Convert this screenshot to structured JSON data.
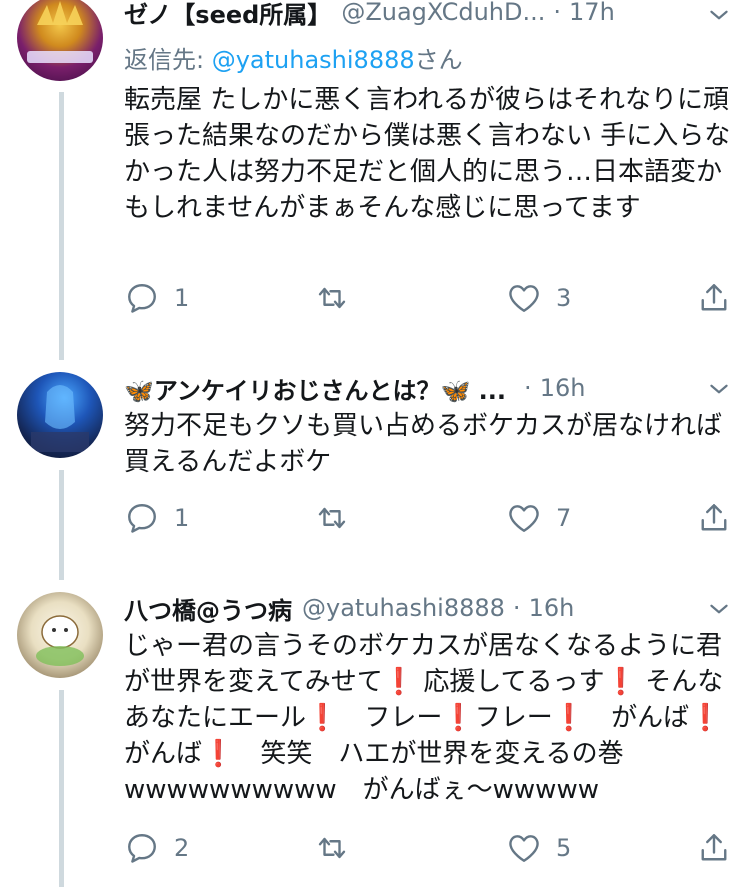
{
  "tweets": [
    {
      "name": "ゼノ【seed所属】",
      "handle": "@ZuagXCduhD...",
      "time": "17h",
      "reply_prefix": "返信先: ",
      "reply_handle": "@yatuhashi8888",
      "reply_suffix": "さん",
      "text": "転売屋 たしかに悪く言われるが彼らはそれなりに頑張った結果なのだから僕は悪く言わない 手に入らなかった人は努力不足だと個人的に思う…日本語変かもしれませんがまぁそんな感じに思ってます",
      "replies": "1",
      "retweets": "",
      "likes": "3"
    },
    {
      "name": "🦋アンケイリおじさんとは？🦋 ...",
      "handle": "",
      "time": "16h",
      "text": "努力不足もクソも買い占めるボケカスが居なければ買えるんだよボケ",
      "replies": "1",
      "retweets": "",
      "likes": "7"
    },
    {
      "name": "八つ橋@うつ病",
      "handle": "@yatuhashi8888",
      "time": "16h",
      "text": "じゃー君の言うそのボケカスが居なくなるように君が世界を変えてみせて❗️ 応援してるっす❗️ そんなあなたにエール❗️　フレー❗️フレー❗️　がんば❗️ がんば❗️　笑笑　ハエが世界を変えるの巻wwwwwwwwww　がんばぇ〜wwwww",
      "replies": "2",
      "retweets": "",
      "likes": "5"
    }
  ],
  "icons": [
    "reply-icon",
    "retweet-icon",
    "like-icon",
    "share-icon",
    "chevron-down-icon"
  ],
  "colors": {
    "text": "#14171a",
    "secondary": "#657786",
    "link": "#1da1f2",
    "thread_line": "#cfd9de"
  }
}
